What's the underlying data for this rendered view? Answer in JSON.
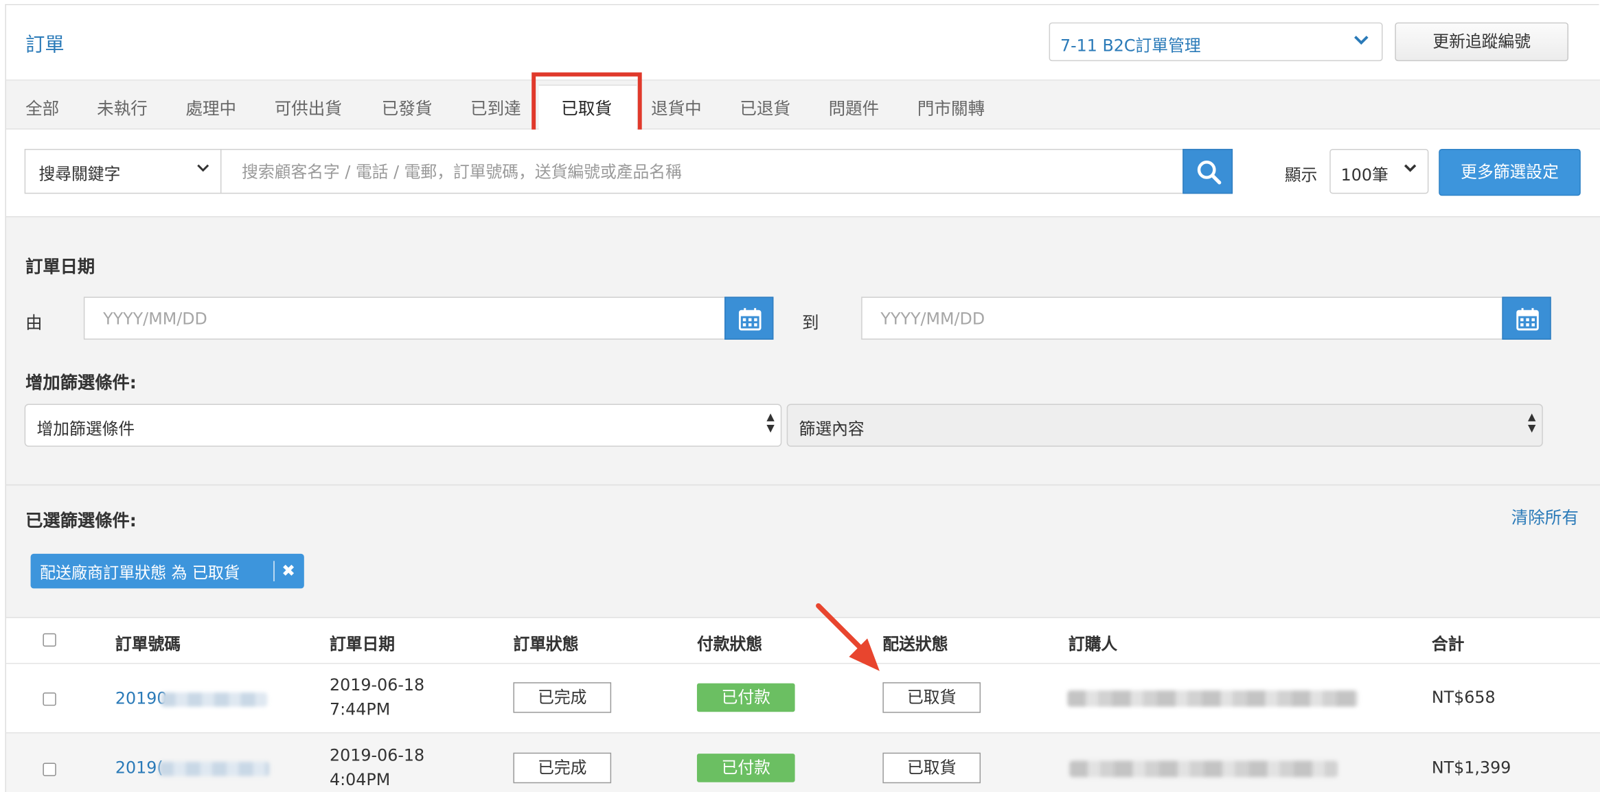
{
  "header": {
    "title": "訂單",
    "store_select": "7-11 B2C訂單管理",
    "update_button": "更新追蹤編號"
  },
  "tabs": [
    {
      "label": "全部"
    },
    {
      "label": "未執行"
    },
    {
      "label": "處理中"
    },
    {
      "label": "可供出貨"
    },
    {
      "label": "已發貨"
    },
    {
      "label": "已到達"
    },
    {
      "label": "已取貨",
      "active": true
    },
    {
      "label": "退貨中"
    },
    {
      "label": "已退貨"
    },
    {
      "label": "問題件"
    },
    {
      "label": "門市關轉"
    }
  ],
  "search": {
    "keyword_select": "搜尋關鍵字",
    "placeholder": "搜索顧客名字 / 電話 / 電郵，訂單號碼，送貨編號或產品名稱",
    "show_label": "顯示",
    "page_size": "100筆",
    "more_filters": "更多篩選設定"
  },
  "filters": {
    "order_date_label": "訂單日期",
    "from_label": "由",
    "to_label": "到",
    "date_placeholder": "YYYY/MM/DD",
    "add_condition_label": "增加篩選條件:",
    "add_condition_select": "增加篩選條件",
    "filter_content_select": "篩選內容",
    "selected_label": "已選篩選條件:",
    "clear_all": "清除所有",
    "chip": "配送廠商訂單狀態 為 已取貨"
  },
  "table": {
    "headers": {
      "order_no": "訂單號碼",
      "order_date": "訂單日期",
      "order_status": "訂單狀態",
      "payment_status": "付款狀態",
      "delivery_status": "配送狀態",
      "buyer": "訂購人",
      "total": "合計"
    },
    "rows": [
      {
        "order_no": "20190",
        "date": "2019-06-18",
        "time": "7:44PM",
        "order_status": "已完成",
        "payment_status": "已付款",
        "delivery_status": "已取貨",
        "total": "NT$658"
      },
      {
        "order_no": "2019(",
        "date": "2019-06-18",
        "time": "4:04PM",
        "order_status": "已完成",
        "payment_status": "已付款",
        "delivery_status": "已取貨",
        "total": "NT$1,399"
      }
    ]
  },
  "colors": {
    "link_blue": "#2a7ab8",
    "primary_button": "#3d95dc",
    "paid_green": "#6bbf62",
    "highlight_red": "#e0392b"
  }
}
